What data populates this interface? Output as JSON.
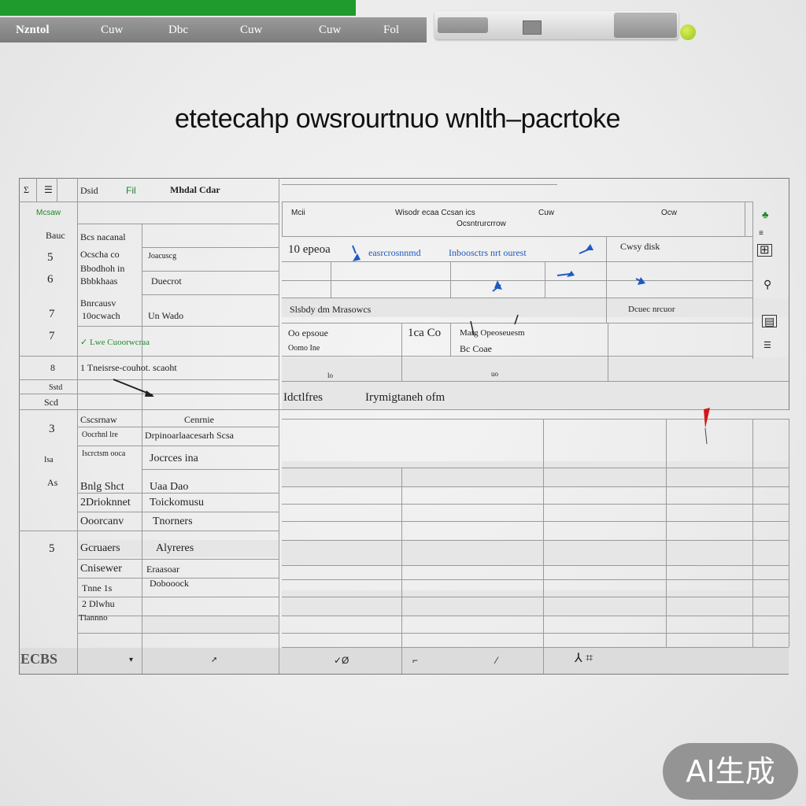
{
  "menubar": {
    "items": [
      "Nzntol",
      "Cuw",
      "Dbc",
      "Cuw",
      "Cuw",
      "Fol"
    ]
  },
  "headline": "etetecahp owsrourtnuo wnlth–pacrtoke",
  "sheet": {
    "header": {
      "col1": "Dsid",
      "col2": "Fil",
      "col3": "Mhdal Cdar"
    },
    "right_header": {
      "a": "Mcii",
      "b": "Wisodr ecaa Ccsan ics",
      "b2": "Ocsntrurcrrow",
      "c": "Cuw",
      "d": "Ocw"
    },
    "left_rows": [
      {
        "num": "Mcsaw",
        "a": "",
        "b": ""
      },
      {
        "num": "Bauc",
        "a": "Bcs nacanal",
        "b": ""
      },
      {
        "num": "5",
        "a": "Ocscha co",
        "b": "Joacuscg"
      },
      {
        "num": "",
        "a": "Bbodhoh in",
        "b": ""
      },
      {
        "num": "6",
        "a": "Bbbkhaas",
        "b": "Duecrot"
      },
      {
        "num": "",
        "a": "Bnrcausv",
        "b": ""
      },
      {
        "num": "7",
        "a": "10ocwach",
        "b": "Un Wado"
      },
      {
        "num": "7",
        "a": "✓ Lwe Cuoorwcraa",
        "b": ""
      },
      {
        "num": "8",
        "a": "1 Tneisrse-couhot. scaoht",
        "b": ""
      }
    ],
    "mid_rows": {
      "r1_label": "10 epeoa",
      "r1_text": "easrcrosnnmd",
      "r1_text2": "Inboosctrs nrt ourest",
      "r1_right": "Cwsy disk",
      "r3": "Slsbdy dm Mrasowcs",
      "r3_right": "Dcuec nrcuor",
      "r4_label": "Oo epsoue",
      "r4_b": "Oomo Ine",
      "r4_c": "1ca Co",
      "r4_d": "Marg Opeoseuesm",
      "r4_e": "Bc Coae",
      "r5": "lo",
      "r5b": "uo",
      "wide_row_a": "Idctlfres",
      "wide_row_b": "Irymigtaneh ofm"
    },
    "side_labels": [
      "Sstd",
      "Scd"
    ],
    "lower_left": [
      {
        "a": "Cscsrnaw",
        "b": "Cenrnie"
      },
      {
        "a": "Oocrhnl lre",
        "b": "Drpinoarlaacesarh Scsa"
      },
      {
        "a": "Iscrctsm ooca",
        "b": "Jocrces ina"
      },
      {
        "a": "Bnlg Shct",
        "b": "Uaa Dao"
      },
      {
        "a": "2Drioknnet",
        "b": "Toickomusu"
      },
      {
        "a": "Ooorcanv",
        "b": "Tnorners"
      },
      {
        "a": "Gcruaers",
        "b": "Alyreres"
      },
      {
        "a": "Cnisewer",
        "b": "Eraasoar"
      },
      {
        "a": "Tnne 1s",
        "b": "Dobooock"
      },
      {
        "a": "2 Dlwhu",
        "b": ""
      },
      {
        "a": "Tlannno",
        "b": ""
      }
    ],
    "lower_nums": [
      "3",
      "Isa",
      "As",
      "5"
    ],
    "footer": {
      "corner": "ECBS"
    }
  },
  "badge": "AI生成",
  "colors": {
    "green": "#1f9a2c",
    "accent_blue": "#1f5bbf",
    "marker_red": "#d01818"
  }
}
